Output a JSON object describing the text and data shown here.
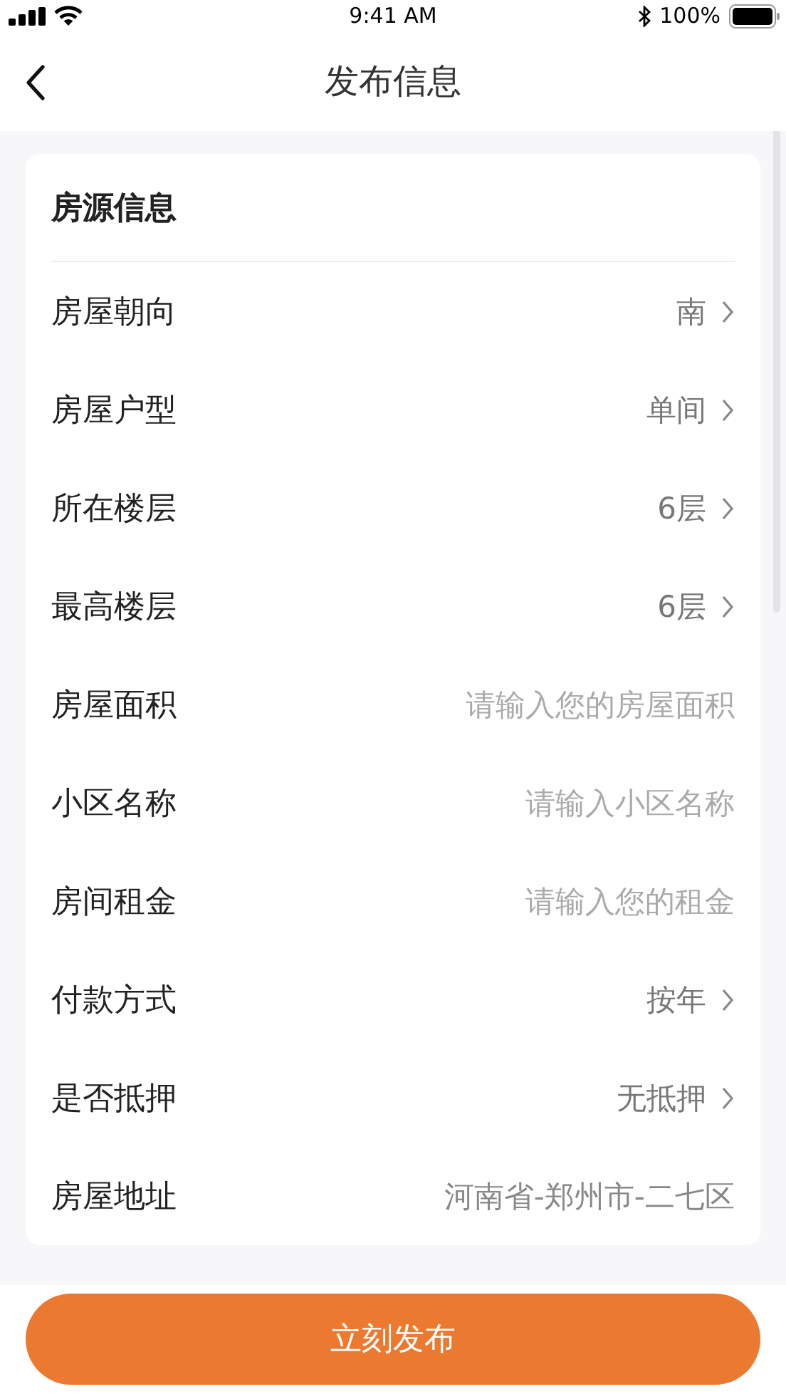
{
  "status_bar": {
    "time": "9:41 AM",
    "battery": "100%"
  },
  "header": {
    "title": "发布信息"
  },
  "section": {
    "title": "房源信息"
  },
  "rows": [
    {
      "kind": "select",
      "label": "房屋朝向",
      "value": "南"
    },
    {
      "kind": "select",
      "label": "房屋户型",
      "value": "单间"
    },
    {
      "kind": "select",
      "label": "所在楼层",
      "value": "6层"
    },
    {
      "kind": "select",
      "label": "最高楼层",
      "value": "6层"
    },
    {
      "kind": "input",
      "label": "房屋面积",
      "placeholder": "请输入您的房屋面积"
    },
    {
      "kind": "input",
      "label": "小区名称",
      "placeholder": "请输入小区名称"
    },
    {
      "kind": "input",
      "label": "房间租金",
      "placeholder": "请输入您的租金"
    },
    {
      "kind": "select",
      "label": "付款方式",
      "value": "按年"
    },
    {
      "kind": "select",
      "label": "是否抵押",
      "value": "无抵押"
    },
    {
      "kind": "text",
      "label": "房屋地址",
      "value": "河南省-郑州市-二七区"
    }
  ],
  "submit_button": "立刻发布"
}
